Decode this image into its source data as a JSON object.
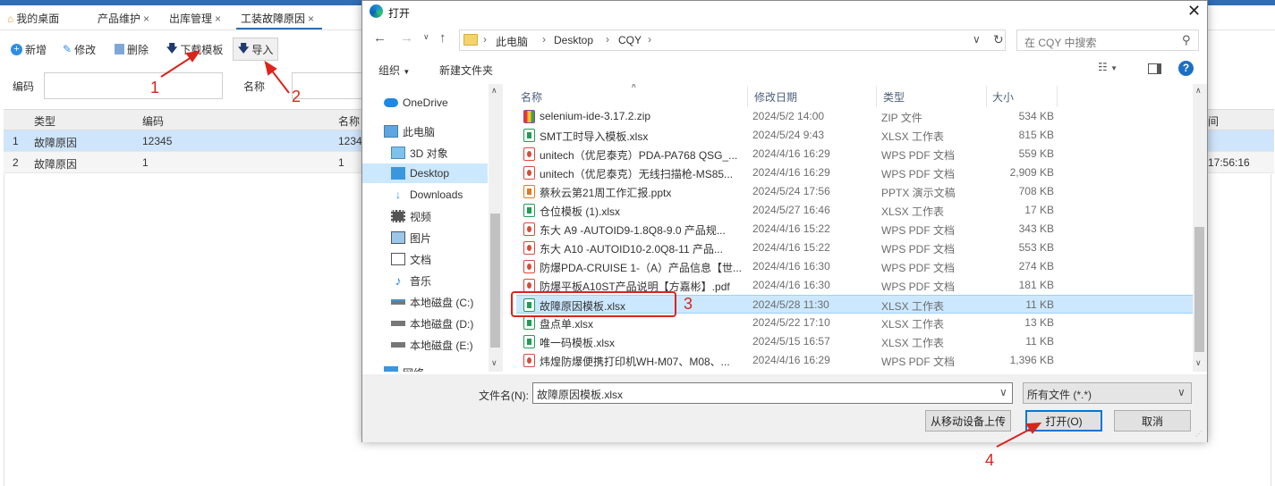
{
  "tabs": [
    {
      "label": "我的桌面"
    },
    {
      "label": "产品维护"
    },
    {
      "label": "出库管理"
    },
    {
      "label": "工装故障原因"
    }
  ],
  "toolbar": {
    "add": "新增",
    "edit": "修改",
    "delete": "删除",
    "download": "下载模板",
    "import": "导入"
  },
  "filters": {
    "code_label": "编码",
    "name_label": "名称"
  },
  "grid": {
    "headers": [
      "类型",
      "编码",
      "名称",
      "间"
    ],
    "rows": [
      {
        "num": "1",
        "type": "故障原因",
        "code": "12345",
        "name": "1234",
        "time": ""
      },
      {
        "num": "2",
        "type": "故障原因",
        "code": "1",
        "name": "1",
        "time": "17:56:16"
      }
    ]
  },
  "annotations": [
    "1",
    "2",
    "3",
    "4"
  ],
  "dialog": {
    "title": "打开",
    "breadcrumb": [
      "此电脑",
      "Desktop",
      "CQY"
    ],
    "search_placeholder": "在 CQY 中搜索",
    "organize": "组织",
    "new_folder": "新建文件夹",
    "sidebar": [
      {
        "label": "OneDrive",
        "icon": "cloud-icon"
      },
      {
        "label": "此电脑",
        "icon": "computer-icon"
      },
      {
        "label": "3D 对象",
        "icon": "cube-icon"
      },
      {
        "label": "Desktop",
        "icon": "desktop-icon"
      },
      {
        "label": "Downloads",
        "icon": "download-icon"
      },
      {
        "label": "视频",
        "icon": "video-icon"
      },
      {
        "label": "图片",
        "icon": "picture-icon"
      },
      {
        "label": "文档",
        "icon": "document-icon"
      },
      {
        "label": "音乐",
        "icon": "music-icon"
      },
      {
        "label": "本地磁盘 (C:)",
        "icon": "drive-icon"
      },
      {
        "label": "本地磁盘 (D:)",
        "icon": "drive-icon"
      },
      {
        "label": "本地磁盘 (E:)",
        "icon": "drive-icon"
      },
      {
        "label": "网络",
        "icon": "network-icon"
      }
    ],
    "columns": {
      "name": "名称",
      "date": "修改日期",
      "type": "类型",
      "size": "大小"
    },
    "files": [
      {
        "name": "selenium-ide-3.17.2.zip",
        "date": "2024/5/2 14:00",
        "type": "ZIP 文件",
        "size": "534 KB",
        "kind": "zip"
      },
      {
        "name": "SMT工时导入模板.xlsx",
        "date": "2024/5/24 9:43",
        "type": "XLSX 工作表",
        "size": "815 KB",
        "kind": "xlsx"
      },
      {
        "name": "unitech（优尼泰克）PDA-PA768 QSG_...",
        "date": "2024/4/16 16:29",
        "type": "WPS PDF 文档",
        "size": "559 KB",
        "kind": "pdf"
      },
      {
        "name": "unitech（优尼泰克）无线扫描枪-MS85...",
        "date": "2024/4/16 16:29",
        "type": "WPS PDF 文档",
        "size": "2,909 KB",
        "kind": "pdf"
      },
      {
        "name": "蔡秋云第21周工作汇报.pptx",
        "date": "2024/5/24 17:56",
        "type": "PPTX 演示文稿",
        "size": "708 KB",
        "kind": "pptx"
      },
      {
        "name": "仓位模板 (1).xlsx",
        "date": "2024/5/27 16:46",
        "type": "XLSX 工作表",
        "size": "17 KB",
        "kind": "xlsx"
      },
      {
        "name": "东大 A9 -AUTOID9-1.8Q8-9.0 产品规...",
        "date": "2024/4/16 15:22",
        "type": "WPS PDF 文档",
        "size": "343 KB",
        "kind": "pdf"
      },
      {
        "name": "东大 A10 -AUTOID10-2.0Q8-11 产品...",
        "date": "2024/4/16 15:22",
        "type": "WPS PDF 文档",
        "size": "553 KB",
        "kind": "pdf"
      },
      {
        "name": "防爆PDA-CRUISE 1-（A）产品信息【世...",
        "date": "2024/4/16 16:30",
        "type": "WPS PDF 文档",
        "size": "274 KB",
        "kind": "pdf"
      },
      {
        "name": "防爆平板A10ST产品说明【方嘉彬】.pdf",
        "date": "2024/4/16 16:30",
        "type": "WPS PDF 文档",
        "size": "181 KB",
        "kind": "pdf"
      },
      {
        "name": "故障原因模板.xlsx",
        "date": "2024/5/28 11:30",
        "type": "XLSX 工作表",
        "size": "11 KB",
        "kind": "xlsx"
      },
      {
        "name": "盘点单.xlsx",
        "date": "2024/5/22 17:10",
        "type": "XLSX 工作表",
        "size": "13 KB",
        "kind": "xlsx"
      },
      {
        "name": "唯一码模板.xlsx",
        "date": "2024/5/15 16:57",
        "type": "XLSX 工作表",
        "size": "11 KB",
        "kind": "xlsx"
      },
      {
        "name": "炜煌防爆便携打印机WH-M07、M08、...",
        "date": "2024/4/16 16:29",
        "type": "WPS PDF 文档",
        "size": "1,396 KB",
        "kind": "pdf"
      }
    ],
    "selected_index": 10,
    "filename_label": "文件名(N):",
    "filename_value": "故障原因模板.xlsx",
    "filetype_value": "所有文件 (*.*)",
    "upload_button": "从移动设备上传",
    "open_button": "打开(O)",
    "cancel_button": "取消"
  },
  "colors": {
    "accent": "#2f6eb5",
    "selection": "#cce8ff",
    "annotation": "#d9251d"
  }
}
